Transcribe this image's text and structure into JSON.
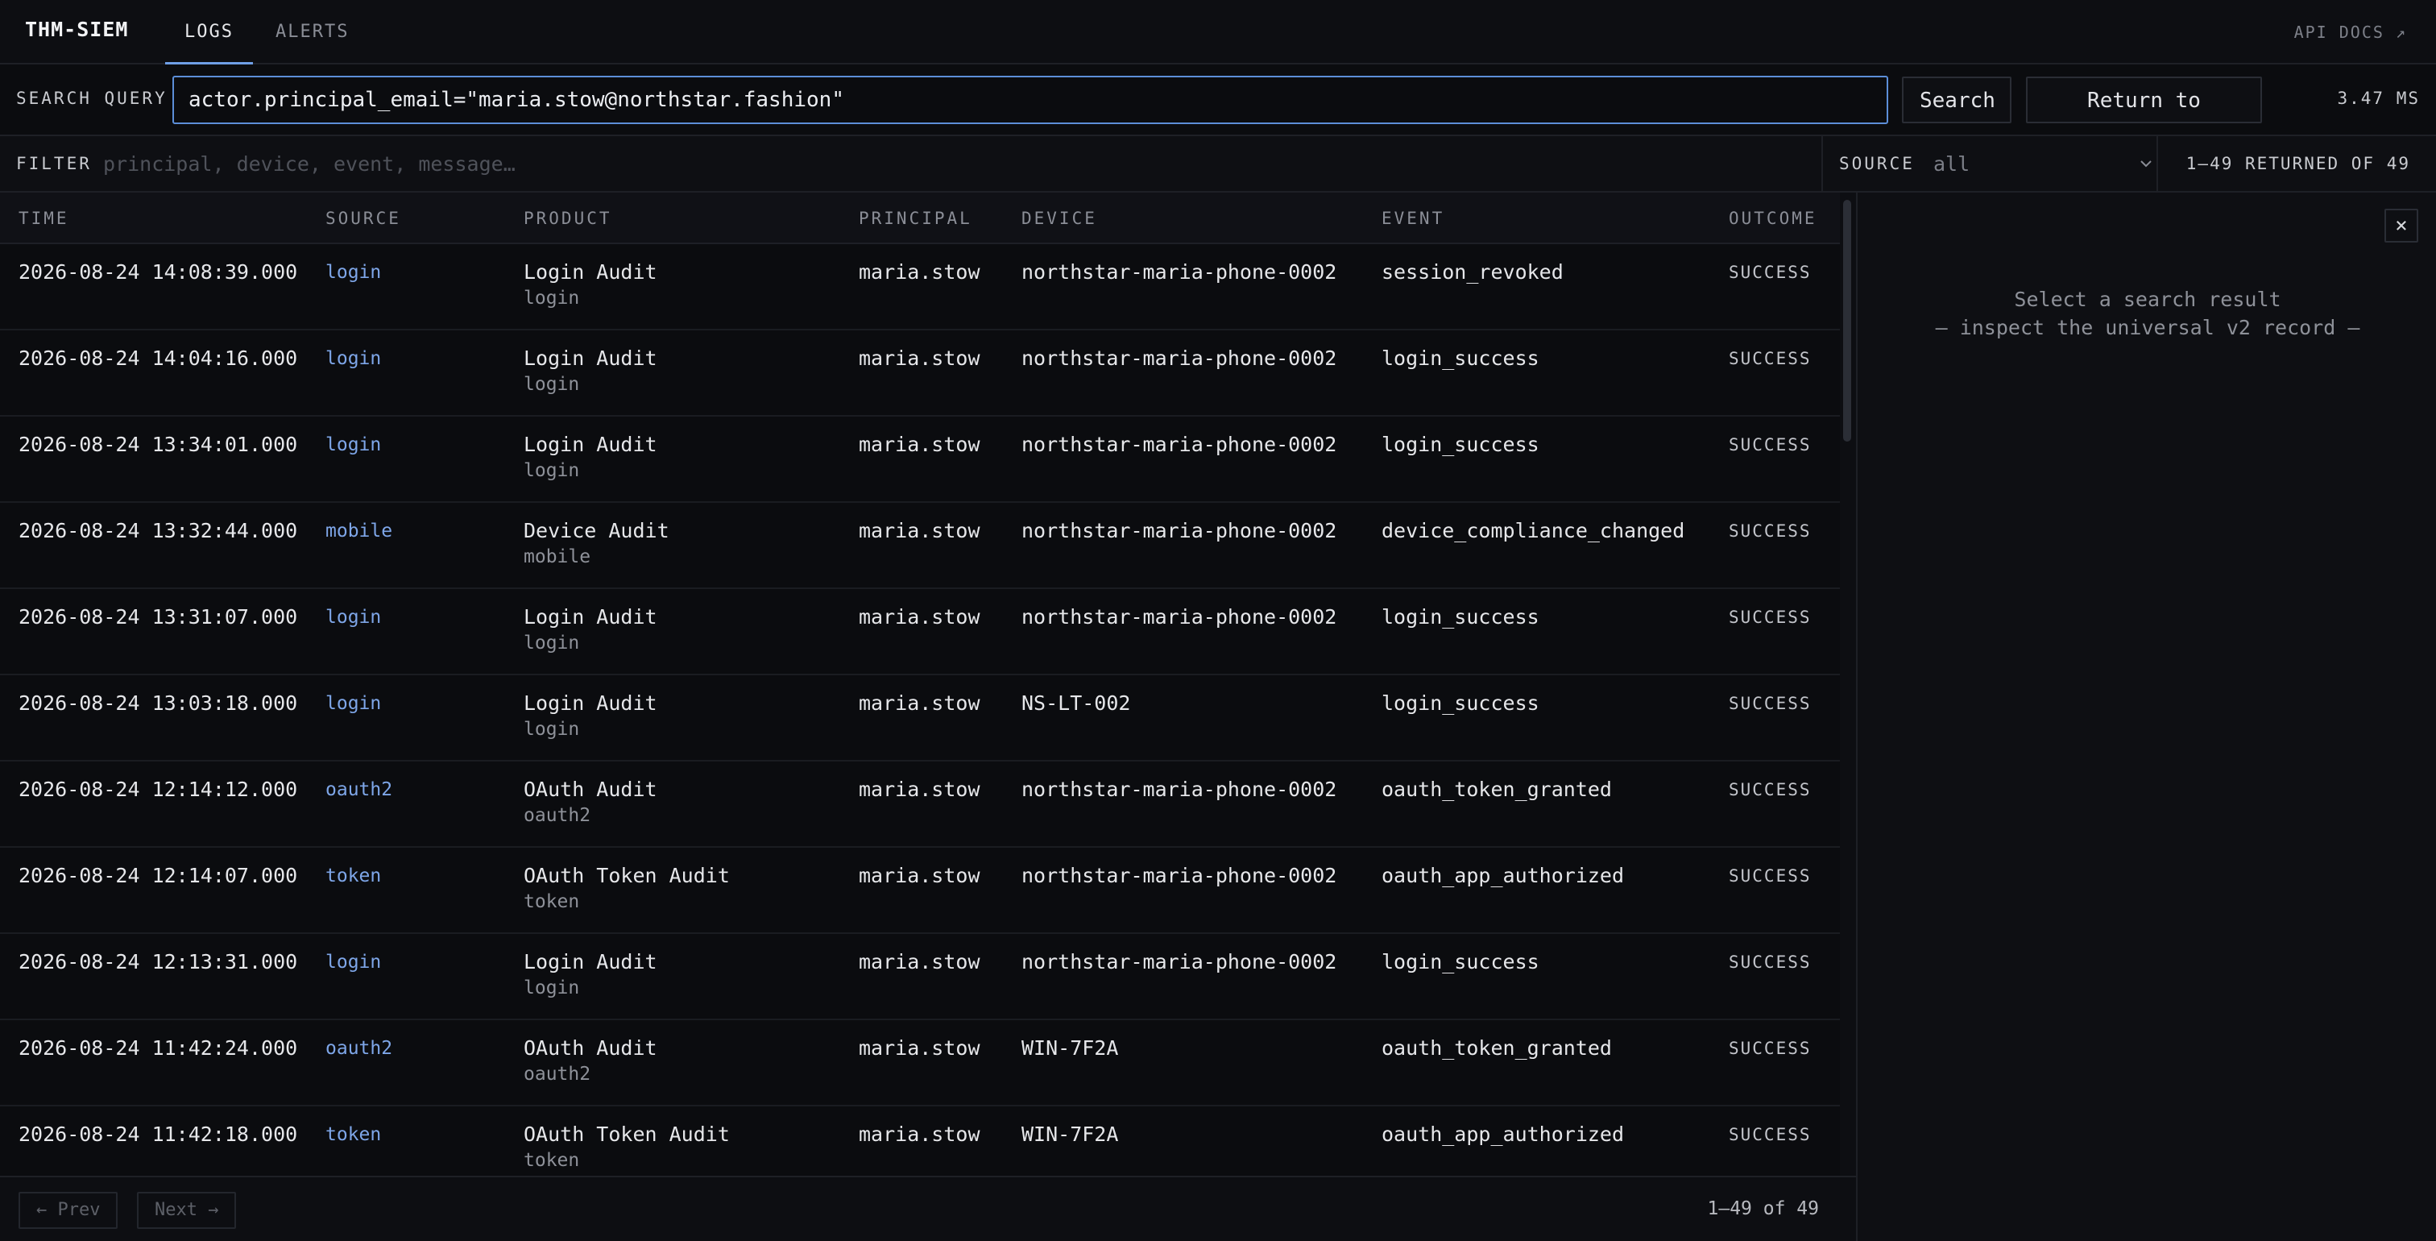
{
  "brand": "THM-SIEM",
  "nav": {
    "tabs": [
      {
        "label": "LOGS",
        "active": true
      },
      {
        "label": "ALERTS",
        "active": false
      }
    ],
    "api_docs": "API DOCS ↗"
  },
  "search": {
    "label": "SEARCH QUERY",
    "value": "actor.principal_email=\"maria.stow@northstar.fashion\"",
    "search_button": "Search",
    "return_button": "Return to browse",
    "latency": "3.47 MS"
  },
  "filter": {
    "label": "FILTER",
    "placeholder": "principal, device, event, message…",
    "source_label": "SOURCE",
    "source_value": "all",
    "returned": "1–49 RETURNED OF 49"
  },
  "table": {
    "columns": [
      "TIME",
      "SOURCE",
      "PRODUCT",
      "PRINCIPAL",
      "DEVICE",
      "EVENT",
      "OUTCOME"
    ],
    "rows": [
      {
        "time": "2026-08-24 14:08:39.000",
        "source": "login",
        "product": "Login Audit",
        "product_sub": "login",
        "principal": "maria.stow",
        "device": "northstar-maria-phone-0002",
        "event": "session_revoked",
        "outcome": "SUCCESS"
      },
      {
        "time": "2026-08-24 14:04:16.000",
        "source": "login",
        "product": "Login Audit",
        "product_sub": "login",
        "principal": "maria.stow",
        "device": "northstar-maria-phone-0002",
        "event": "login_success",
        "outcome": "SUCCESS"
      },
      {
        "time": "2026-08-24 13:34:01.000",
        "source": "login",
        "product": "Login Audit",
        "product_sub": "login",
        "principal": "maria.stow",
        "device": "northstar-maria-phone-0002",
        "event": "login_success",
        "outcome": "SUCCESS"
      },
      {
        "time": "2026-08-24 13:32:44.000",
        "source": "mobile",
        "product": "Device Audit",
        "product_sub": "mobile",
        "principal": "maria.stow",
        "device": "northstar-maria-phone-0002",
        "event": "device_compliance_changed",
        "outcome": "SUCCESS"
      },
      {
        "time": "2026-08-24 13:31:07.000",
        "source": "login",
        "product": "Login Audit",
        "product_sub": "login",
        "principal": "maria.stow",
        "device": "northstar-maria-phone-0002",
        "event": "login_success",
        "outcome": "SUCCESS"
      },
      {
        "time": "2026-08-24 13:03:18.000",
        "source": "login",
        "product": "Login Audit",
        "product_sub": "login",
        "principal": "maria.stow",
        "device": "NS-LT-002",
        "event": "login_success",
        "outcome": "SUCCESS"
      },
      {
        "time": "2026-08-24 12:14:12.000",
        "source": "oauth2",
        "product": "OAuth Audit",
        "product_sub": "oauth2",
        "principal": "maria.stow",
        "device": "northstar-maria-phone-0002",
        "event": "oauth_token_granted",
        "outcome": "SUCCESS"
      },
      {
        "time": "2026-08-24 12:14:07.000",
        "source": "token",
        "product": "OAuth Token Audit",
        "product_sub": "token",
        "principal": "maria.stow",
        "device": "northstar-maria-phone-0002",
        "event": "oauth_app_authorized",
        "outcome": "SUCCESS"
      },
      {
        "time": "2026-08-24 12:13:31.000",
        "source": "login",
        "product": "Login Audit",
        "product_sub": "login",
        "principal": "maria.stow",
        "device": "northstar-maria-phone-0002",
        "event": "login_success",
        "outcome": "SUCCESS"
      },
      {
        "time": "2026-08-24 11:42:24.000",
        "source": "oauth2",
        "product": "OAuth Audit",
        "product_sub": "oauth2",
        "principal": "maria.stow",
        "device": "WIN-7F2A",
        "event": "oauth_token_granted",
        "outcome": "SUCCESS"
      },
      {
        "time": "2026-08-24 11:42:18.000",
        "source": "token",
        "product": "OAuth Token Audit",
        "product_sub": "token",
        "principal": "maria.stow",
        "device": "WIN-7F2A",
        "event": "oauth_app_authorized",
        "outcome": "SUCCESS"
      }
    ]
  },
  "pager": {
    "prev": "← Prev",
    "next": "Next →",
    "count": "1–49 of 49"
  },
  "detail": {
    "close": "×",
    "line1": "Select a search result",
    "line2": "— inspect the universal v2 record —"
  },
  "icons": {
    "source_dropdown": "chevron-down-icon",
    "close": "close-icon"
  },
  "colors": {
    "accent": "#6f9fe6",
    "source_link": "#7ea6e8"
  }
}
